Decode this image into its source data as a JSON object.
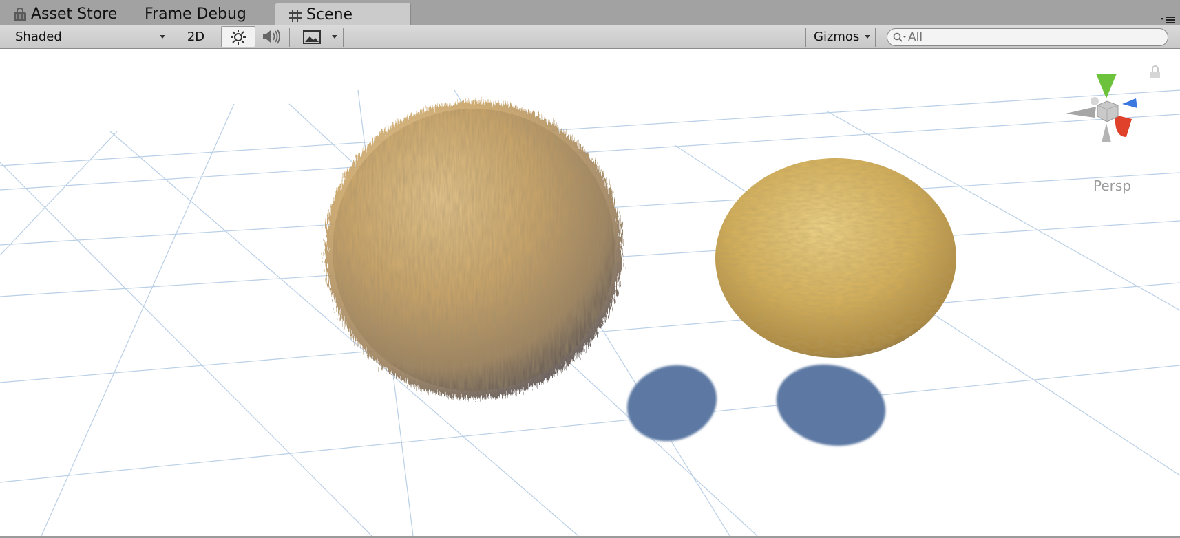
{
  "tabs": [
    {
      "label": "Asset Store",
      "icon": "asset-store-icon",
      "active": false
    },
    {
      "label": "Frame Debug",
      "icon": "",
      "active": false
    },
    {
      "label": "Scene",
      "icon": "grid-hash-icon",
      "active": true
    }
  ],
  "toolbar": {
    "draw_mode": "Shaded",
    "mode_2d_label": "2D",
    "lighting_icon": "sun-icon",
    "audio_icon": "speaker-icon",
    "effects_icon": "image-icon",
    "gizmos_label": "Gizmos",
    "search_placeholder": "All"
  },
  "scene": {
    "projection_label": "Persp",
    "objects": [
      {
        "name": "fur-sphere",
        "material": "fur"
      },
      {
        "name": "textured-sphere",
        "material": "fur-texture"
      }
    ],
    "colors": {
      "background": "#ffffff",
      "grid": "#b9cfe6",
      "fur": "#c9a468",
      "shadow": "#5b78a3",
      "axis_x": "#e0412a",
      "axis_y": "#6cc23a",
      "axis_z": "#3a78e0"
    }
  }
}
